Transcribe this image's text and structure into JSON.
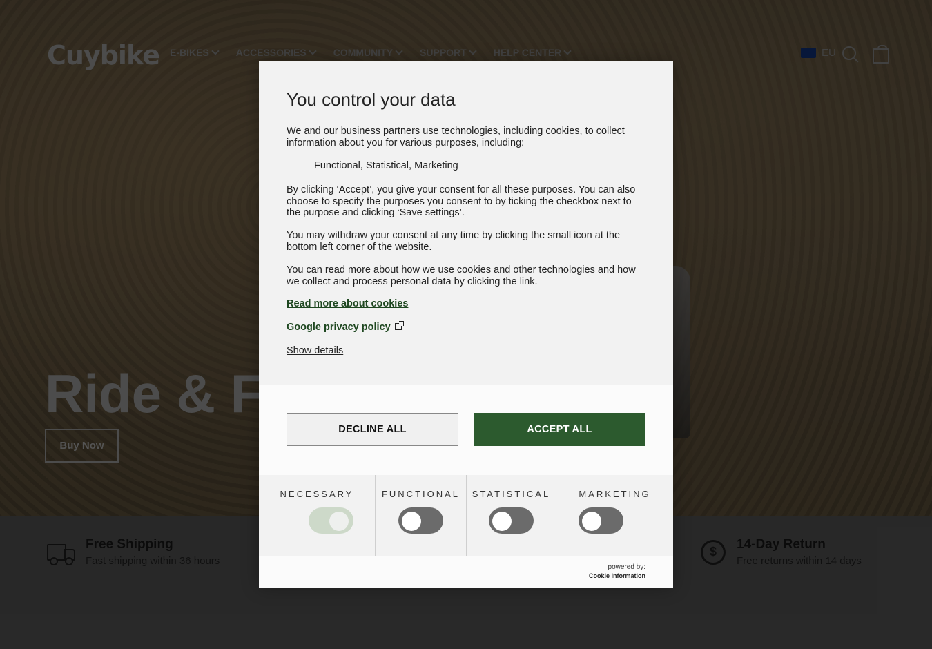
{
  "header": {
    "logo": "Cuybike",
    "nav": [
      "E-BIKES",
      "ACCESSORIES",
      "COMMUNITY",
      "SUPPORT",
      "HELP CENTER"
    ],
    "region": "EU"
  },
  "hero": {
    "title": "Ride & Fu",
    "button": "Buy Now"
  },
  "benefits": [
    {
      "title": "Free Shipping",
      "subtitle": "Fast shipping within 36 hours",
      "icon": "truck-icon"
    },
    {
      "title": "14-Day Return",
      "subtitle": "Free returns within 14 days",
      "icon": "return-icon"
    }
  ],
  "consent": {
    "title": "You control your data",
    "intro": "We and our business partners use technologies, including cookies, to collect information about you for various purposes, including:",
    "purposes": "Functional, Statistical, Marketing",
    "para1": "By clicking ‘Accept’, you give your consent for all these purposes. You can also choose to specify the purposes you consent to by ticking the checkbox next to the purpose and clicking ‘Save settings’.",
    "para2": "You may withdraw your consent at any time by clicking the small icon at the bottom left corner of the website.",
    "para3": "You can read more about how we use cookies and other technologies and how we collect and process personal data by clicking the link.",
    "link_cookies": "Read more about cookies",
    "link_privacy": "Google privacy policy",
    "show_details": "Show details",
    "decline": "DECLINE ALL",
    "accept": "ACCEPT ALL",
    "categories": [
      {
        "label": "NECESSARY",
        "enabled": true
      },
      {
        "label": "FUNCTIONAL",
        "enabled": false
      },
      {
        "label": "STATISTICAL",
        "enabled": false
      },
      {
        "label": "MARKETING",
        "enabled": false
      }
    ],
    "powered_by": "powered by:",
    "provider": "Cookie Information"
  },
  "colors": {
    "accent": "#2c5a2e",
    "link": "#1e4720"
  }
}
